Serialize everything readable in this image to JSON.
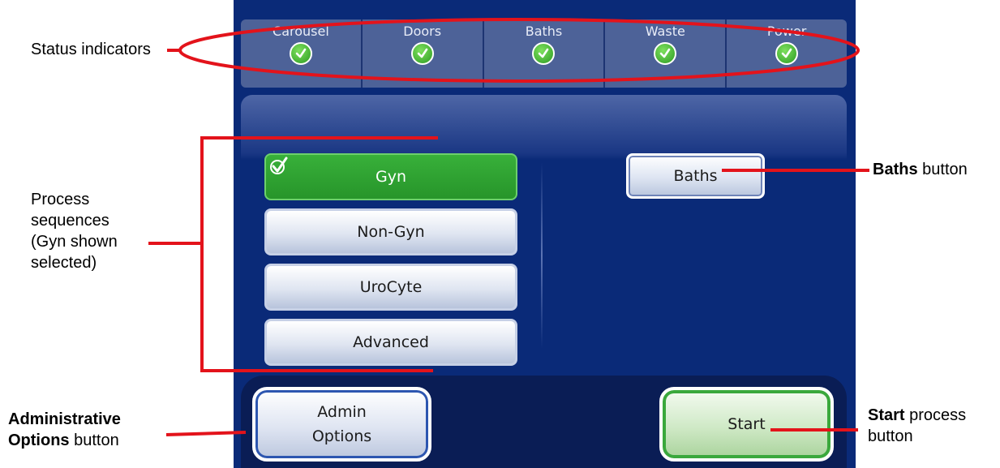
{
  "status_indicators": [
    {
      "label": "Carousel",
      "icon": "check-icon"
    },
    {
      "label": "Doors",
      "icon": "check-icon"
    },
    {
      "label": "Baths",
      "icon": "check-icon"
    },
    {
      "label": "Waste",
      "icon": "check-icon"
    },
    {
      "label": "Power",
      "icon": "check-icon"
    }
  ],
  "sequences": [
    {
      "label": "Gyn",
      "selected": true
    },
    {
      "label": "Non-Gyn",
      "selected": false
    },
    {
      "label": "UroCyte",
      "selected": false
    },
    {
      "label": "Advanced",
      "selected": false
    }
  ],
  "baths_button": "Baths",
  "admin_button": {
    "line1": "Admin",
    "line2": "Options"
  },
  "start_button": "Start",
  "annotations": {
    "status": "Status indicators",
    "process": [
      "Process",
      "sequences",
      "(Gyn shown",
      "selected)"
    ],
    "baths_bold": "Baths",
    "baths_rest": "button",
    "admin_bold": [
      "Administrative",
      "Options"
    ],
    "admin_rest": "button",
    "start_bold": "Start",
    "start_rest": "process",
    "start_rest2": "button"
  },
  "colors": {
    "screen_bg": "#0a2a78",
    "selected_green": "#2e9f2f",
    "annotation_red": "#e3131b"
  }
}
